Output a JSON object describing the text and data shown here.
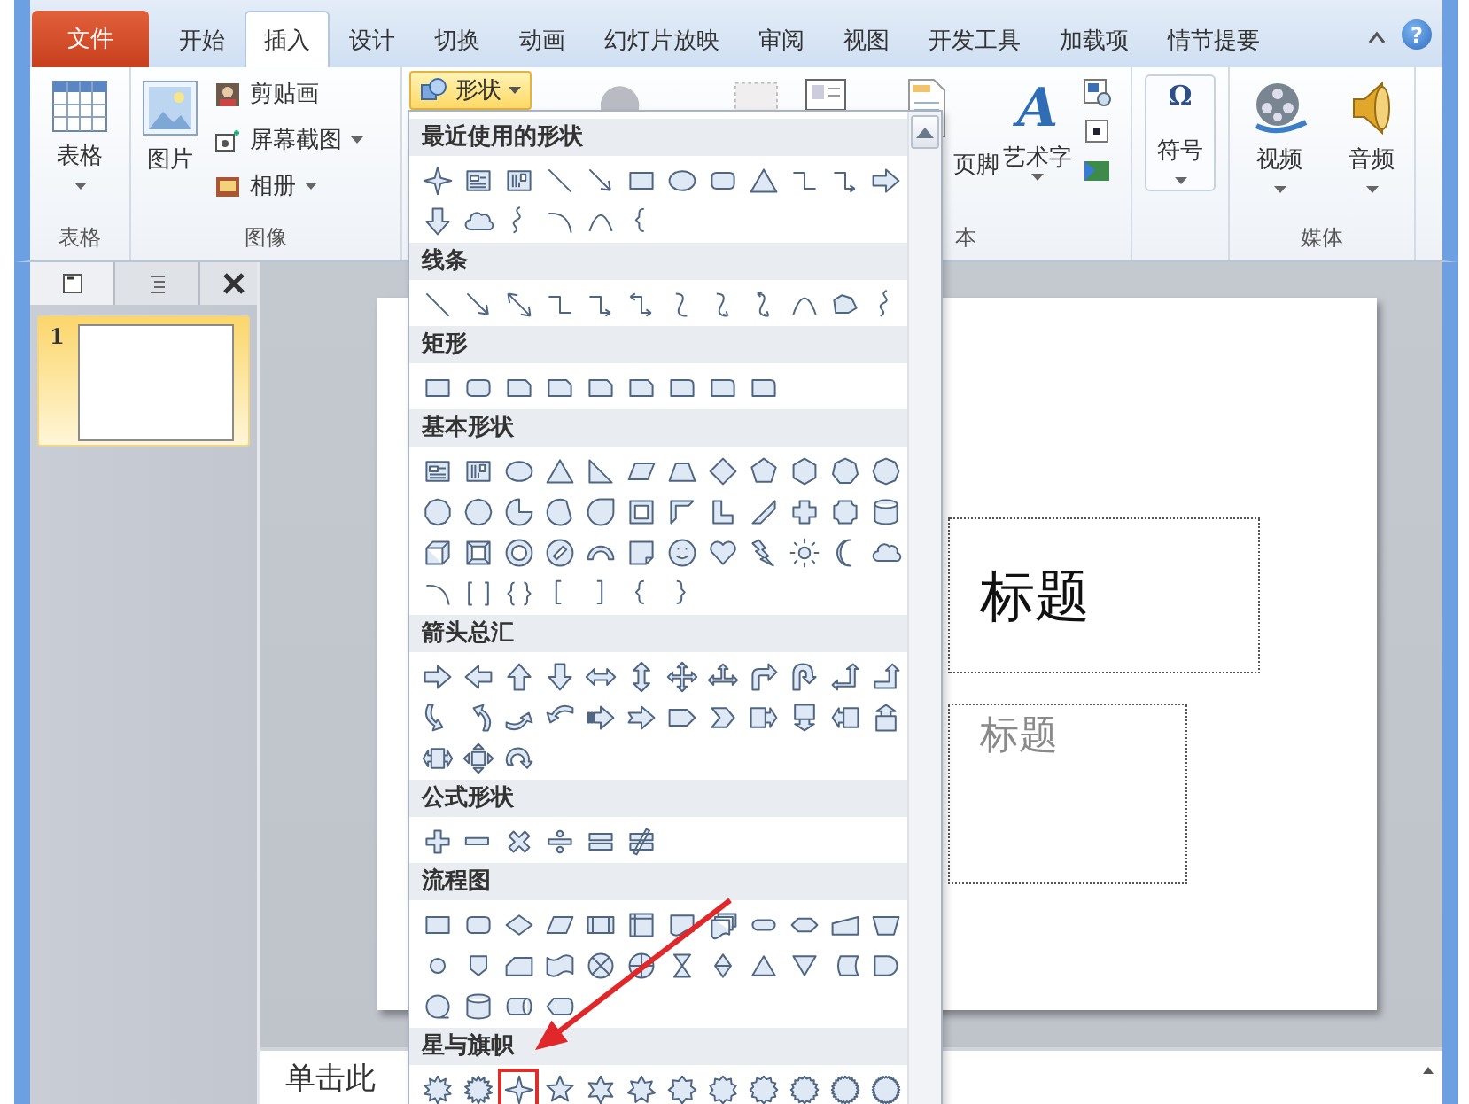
{
  "tabs": [
    {
      "label": "文件",
      "kind": "file",
      "selected": false
    },
    {
      "label": "开始",
      "kind": "tab",
      "selected": false
    },
    {
      "label": "插入",
      "kind": "tab",
      "selected": true
    },
    {
      "label": "设计",
      "kind": "tab",
      "selected": false
    },
    {
      "label": "切换",
      "kind": "tab",
      "selected": false
    },
    {
      "label": "动画",
      "kind": "tab",
      "selected": false
    },
    {
      "label": "幻灯片放映",
      "kind": "tab",
      "selected": false
    },
    {
      "label": "审阅",
      "kind": "tab",
      "selected": false
    },
    {
      "label": "视图",
      "kind": "tab",
      "selected": false
    },
    {
      "label": "开发工具",
      "kind": "tab",
      "selected": false
    },
    {
      "label": "加载项",
      "kind": "tab",
      "selected": false
    },
    {
      "label": "情节提要",
      "kind": "tab",
      "selected": false
    }
  ],
  "help_button": "?",
  "ribbon": {
    "table_button": "表格",
    "table_group": "表格",
    "picture_button": "图片",
    "clipart_button": "剪贴画",
    "screenshot_button": "屏幕截图",
    "album_button": "相册",
    "image_group": "图像",
    "shapes_button": "形状",
    "header_footer_button": "页脚",
    "wordart_glyph": "A",
    "wordart_button": "艺术字",
    "text_group": "本",
    "symbol_glyph": "Ω",
    "symbol_button": "符号",
    "video_button": "视频",
    "audio_button": "音频",
    "media_group": "媒体"
  },
  "slides_panel": {
    "slides": [
      {
        "number": "1",
        "selected": true
      }
    ]
  },
  "slide": {
    "title": "标题",
    "subtitle": "标题"
  },
  "notes": {
    "text": "单击此"
  },
  "shapes_gallery": {
    "sections": [
      {
        "title": "最近使用的形状",
        "shapes": [
          {
            "kind": "star4"
          },
          {
            "kind": "textbox"
          },
          {
            "kind": "vtextbox"
          },
          {
            "kind": "line"
          },
          {
            "kind": "arrowline"
          },
          {
            "kind": "rect"
          },
          {
            "kind": "ellipse"
          },
          {
            "kind": "roundrect"
          },
          {
            "kind": "triangle"
          },
          {
            "kind": "elbow"
          },
          {
            "kind": "elbowarrow"
          },
          {
            "kind": "rightarrow"
          },
          {
            "kind": "downarrow"
          },
          {
            "kind": "cloud"
          },
          {
            "kind": "scribble"
          },
          {
            "kind": "arc"
          },
          {
            "kind": "curve"
          },
          {
            "kind": "brace-l"
          }
        ]
      },
      {
        "title": "线条",
        "shapes": [
          {
            "kind": "line"
          },
          {
            "kind": "arrowline"
          },
          {
            "kind": "dblarrow"
          },
          {
            "kind": "elbow"
          },
          {
            "kind": "elbowarrow"
          },
          {
            "kind": "elbowdbl"
          },
          {
            "kind": "curvedconn"
          },
          {
            "kind": "curvedarrow"
          },
          {
            "kind": "curveddbl"
          },
          {
            "kind": "curve"
          },
          {
            "kind": "freeform"
          },
          {
            "kind": "scribble"
          }
        ]
      },
      {
        "title": "矩形",
        "shapes": [
          {
            "kind": "rect"
          },
          {
            "kind": "roundrect"
          },
          {
            "kind": "snip"
          },
          {
            "kind": "snip"
          },
          {
            "kind": "snip"
          },
          {
            "kind": "snip"
          },
          {
            "kind": "round1"
          },
          {
            "kind": "round1"
          },
          {
            "kind": "round1"
          }
        ]
      },
      {
        "title": "基本形状",
        "shapes": [
          {
            "kind": "textbox"
          },
          {
            "kind": "vtextbox"
          },
          {
            "kind": "ellipse"
          },
          {
            "kind": "triangle"
          },
          {
            "kind": "rtriangle"
          },
          {
            "kind": "parallelogram"
          },
          {
            "kind": "trapezoid"
          },
          {
            "kind": "diamond"
          },
          {
            "kind": "pentagon"
          },
          {
            "kind": "hexagon"
          },
          {
            "kind": "heptagon"
          },
          {
            "kind": "octagon"
          },
          {
            "kind": "decagon"
          },
          {
            "kind": "dodecagon"
          },
          {
            "kind": "pie"
          },
          {
            "kind": "chord"
          },
          {
            "kind": "teardrop"
          },
          {
            "kind": "frame"
          },
          {
            "kind": "halfframe"
          },
          {
            "kind": "lshape"
          },
          {
            "kind": "diagstripe"
          },
          {
            "kind": "cross"
          },
          {
            "kind": "plaque"
          },
          {
            "kind": "cylinder"
          },
          {
            "kind": "cube"
          },
          {
            "kind": "bevel"
          },
          {
            "kind": "donut"
          },
          {
            "kind": "noentry"
          },
          {
            "kind": "blockarc"
          },
          {
            "kind": "foldedcorner"
          },
          {
            "kind": "smiley"
          },
          {
            "kind": "heart"
          },
          {
            "kind": "lightning"
          },
          {
            "kind": "sun"
          },
          {
            "kind": "moon"
          },
          {
            "kind": "cloud"
          },
          {
            "kind": "arc"
          },
          {
            "kind": "bracketpair"
          },
          {
            "kind": "bracepair"
          },
          {
            "kind": "bracket-l"
          },
          {
            "kind": "bracket-r"
          },
          {
            "kind": "brace-l"
          },
          {
            "kind": "brace-r"
          }
        ]
      },
      {
        "title": "箭头总汇",
        "shapes": [
          {
            "kind": "rightarrow"
          },
          {
            "kind": "leftarrow"
          },
          {
            "kind": "uparrow"
          },
          {
            "kind": "downarrow"
          },
          {
            "kind": "lrarrow"
          },
          {
            "kind": "udarrow"
          },
          {
            "kind": "quadarrow"
          },
          {
            "kind": "lrup"
          },
          {
            "kind": "bentarrow"
          },
          {
            "kind": "uturn"
          },
          {
            "kind": "leftup"
          },
          {
            "kind": "bentup"
          },
          {
            "kind": "curvedright"
          },
          {
            "kind": "curvedleft"
          },
          {
            "kind": "curvedup"
          },
          {
            "kind": "curveddown"
          },
          {
            "kind": "stripedright"
          },
          {
            "kind": "notchedright"
          },
          {
            "kind": "homeplate"
          },
          {
            "kind": "chevron"
          },
          {
            "kind": "rightcallout"
          },
          {
            "kind": "downcallout"
          },
          {
            "kind": "leftcallout"
          },
          {
            "kind": "upcallout"
          },
          {
            "kind": "lrcallout"
          },
          {
            "kind": "quadcallout"
          },
          {
            "kind": "circulararrow"
          }
        ]
      },
      {
        "title": "公式形状",
        "shapes": [
          {
            "kind": "plus"
          },
          {
            "kind": "minus"
          },
          {
            "kind": "multiply"
          },
          {
            "kind": "divide"
          },
          {
            "kind": "equal"
          },
          {
            "kind": "notequal"
          }
        ]
      },
      {
        "title": "流程图",
        "shapes": [
          {
            "kind": "rect"
          },
          {
            "kind": "roundrect"
          },
          {
            "kind": "decision"
          },
          {
            "kind": "parallelogram"
          },
          {
            "kind": "predefined"
          },
          {
            "kind": "internalstorage"
          },
          {
            "kind": "document"
          },
          {
            "kind": "multidoc"
          },
          {
            "kind": "terminator"
          },
          {
            "kind": "preparation"
          },
          {
            "kind": "manualinput"
          },
          {
            "kind": "manualop"
          },
          {
            "kind": "connector"
          },
          {
            "kind": "offpage"
          },
          {
            "kind": "card"
          },
          {
            "kind": "punchedtape"
          },
          {
            "kind": "summing"
          },
          {
            "kind": "or"
          },
          {
            "kind": "collate"
          },
          {
            "kind": "sort"
          },
          {
            "kind": "extract"
          },
          {
            "kind": "merge"
          },
          {
            "kind": "storeddata"
          },
          {
            "kind": "delay"
          },
          {
            "kind": "seqstorage"
          },
          {
            "kind": "cylinder"
          },
          {
            "kind": "directstorage"
          },
          {
            "kind": "display"
          }
        ]
      },
      {
        "title": "星与旗帜",
        "shapes": [
          {
            "kind": "burst1"
          },
          {
            "kind": "burst2"
          },
          {
            "kind": "star4",
            "highlighted": true
          },
          {
            "kind": "star5"
          },
          {
            "kind": "star6"
          },
          {
            "kind": "star7"
          },
          {
            "kind": "star8"
          },
          {
            "kind": "star10"
          },
          {
            "kind": "star12"
          },
          {
            "kind": "star16"
          },
          {
            "kind": "star24"
          },
          {
            "kind": "star32"
          }
        ]
      }
    ]
  }
}
